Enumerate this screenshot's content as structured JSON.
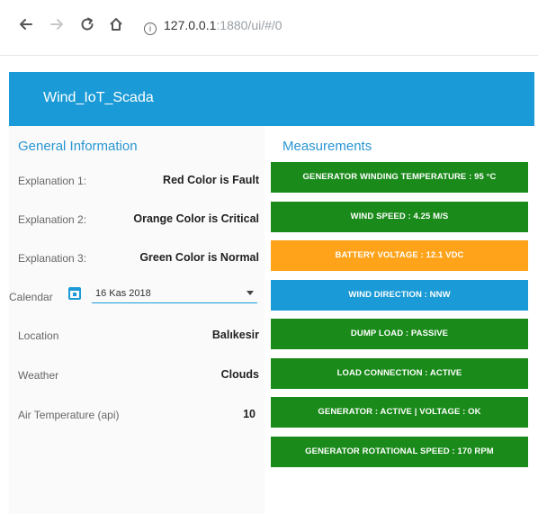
{
  "browser": {
    "url_host": "127.0.0.1",
    "url_rest": ":1880/ui/#/0",
    "info_glyph": "i"
  },
  "app": {
    "title": "Wind_IoT_Scada"
  },
  "general": {
    "title": "General Information",
    "rows": [
      {
        "label": "Explanation 1:",
        "value": "Red Color is Fault"
      },
      {
        "label": "Explanation 2:",
        "value": "Orange Color is Critical"
      },
      {
        "label": "Explanation 3:",
        "value": "Green Color is Normal"
      }
    ],
    "calendar": {
      "label": "Calendar",
      "value": "16 Kas 2018"
    },
    "rows2": [
      {
        "label": "Location",
        "value": "Balıkesir"
      },
      {
        "label": "Weather",
        "value": "Clouds"
      },
      {
        "label": "Air Temperature (api)",
        "value": "10"
      }
    ]
  },
  "measurements": {
    "title": "Measurements",
    "items": [
      {
        "text": "GENERATOR WINDING TEMPERATURE : 95 °C",
        "color": "#1a8a1a"
      },
      {
        "text": "WIND SPEED : 4.25 M/S",
        "color": "#1a8a1a"
      },
      {
        "text": "BATTERY VOLTAGE : 12.1 VDC",
        "color": "#ffa31a"
      },
      {
        "text": "WIND DIRECTION : NNW",
        "color": "#1a9ad6"
      },
      {
        "text": "DUMP LOAD : PASSIVE",
        "color": "#1a8a1a"
      },
      {
        "text": "LOAD CONNECTION : ACTIVE",
        "color": "#1a8a1a"
      },
      {
        "text": "GENERATOR : ACTIVE | VOLTAGE : OK",
        "color": "#1a8a1a"
      },
      {
        "text": "GENERATOR ROTATIONAL SPEED : 170 RPM",
        "color": "#1a8a1a"
      }
    ]
  },
  "icons": {
    "back": "back-arrow-icon",
    "forward": "forward-arrow-icon",
    "reload": "reload-icon",
    "home": "home-icon",
    "info": "info-icon",
    "calendar": "calendar-icon",
    "dropdown": "chevron-down-icon"
  }
}
